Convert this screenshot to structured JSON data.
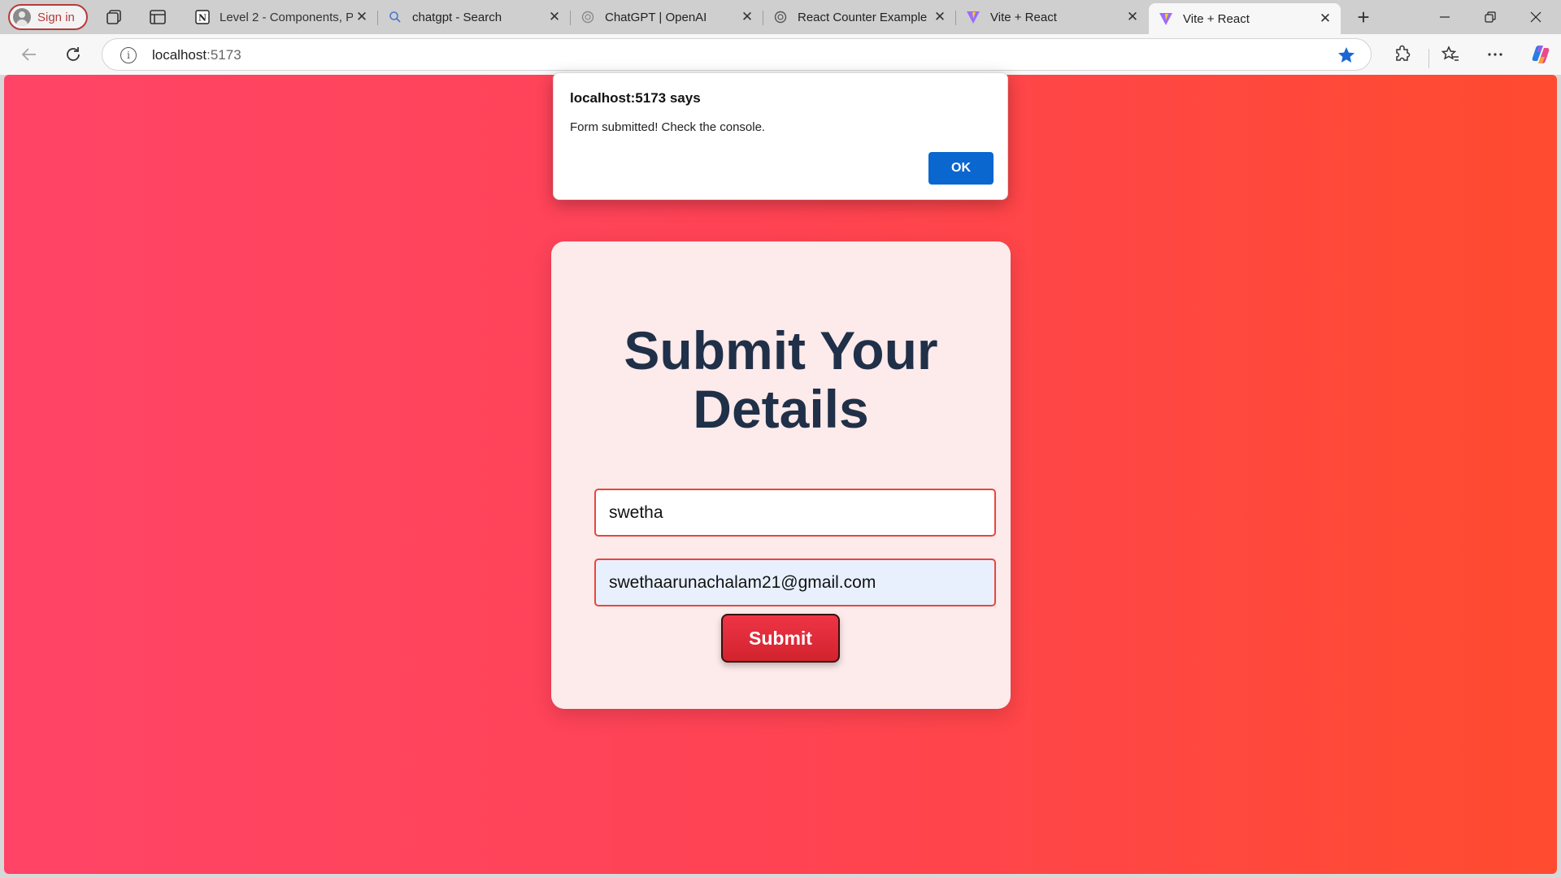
{
  "browser": {
    "signin_label": "Sign in",
    "tabs": [
      {
        "title": "Level 2 - Components, P",
        "favicon": "notion-icon"
      },
      {
        "title": "chatgpt - Search",
        "favicon": "search-icon"
      },
      {
        "title": "ChatGPT | OpenAI",
        "favicon": "openai-icon"
      },
      {
        "title": "React Counter Example",
        "favicon": "openai-icon"
      },
      {
        "title": "Vite + React",
        "favicon": "vite-icon"
      },
      {
        "title": "Vite + React",
        "favicon": "vite-icon",
        "active": true
      }
    ],
    "url_host": "localhost",
    "url_port": ":5173",
    "accent_color": "#0a67cf"
  },
  "page": {
    "heading": "Submit Your Details",
    "name_value": "swetha",
    "email_value": "swethaarunachalam21@gmail.com",
    "submit_label": "Submit",
    "background_gradient": [
      "#ff4467",
      "#ff4b2f"
    ],
    "card_color": "#fdeaea",
    "heading_color": "#1f3048"
  },
  "dialog": {
    "title": "localhost:5173 says",
    "message": "Form submitted! Check the console.",
    "ok_label": "OK"
  }
}
